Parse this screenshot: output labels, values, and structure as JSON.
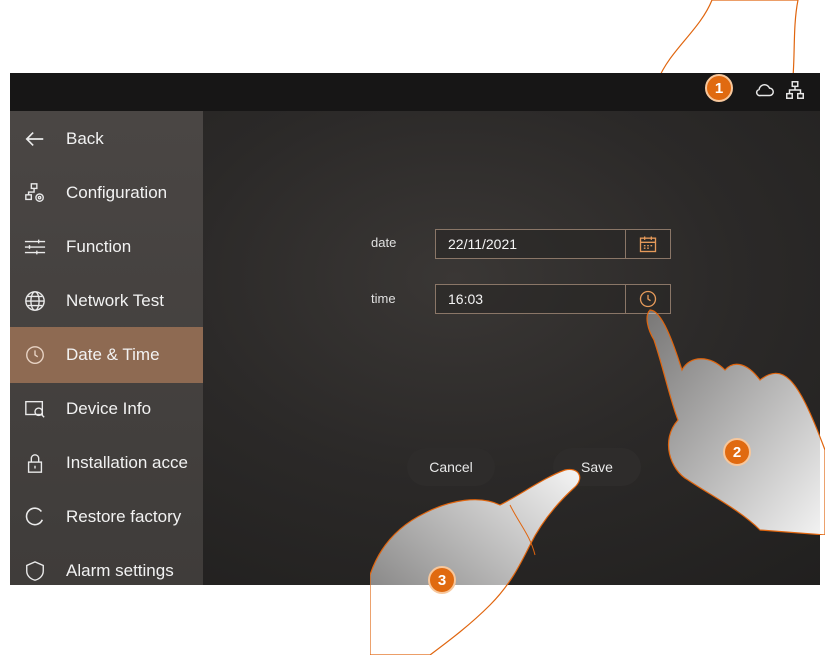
{
  "sidebar": {
    "items": [
      {
        "label": "Back",
        "icon": "back-arrow-icon"
      },
      {
        "label": "Configuration",
        "icon": "configuration-icon"
      },
      {
        "label": "Function",
        "icon": "sliders-icon"
      },
      {
        "label": "Network Test",
        "icon": "globe-icon"
      },
      {
        "label": "Date & Time",
        "icon": "clock-icon"
      },
      {
        "label": "Device Info",
        "icon": "device-info-icon"
      },
      {
        "label": "Installation acce",
        "icon": "lock-icon"
      },
      {
        "label": "Restore factory",
        "icon": "restore-icon"
      },
      {
        "label": "Alarm settings",
        "icon": "shield-icon"
      }
    ]
  },
  "form": {
    "date_label": "date",
    "date_value": "22/11/2021",
    "time_label": "time",
    "time_value": "16:03"
  },
  "buttons": {
    "cancel": "Cancel",
    "save": "Save"
  },
  "callouts": [
    "1",
    "2",
    "3"
  ],
  "colors": {
    "accent": "#e59a5a",
    "active_item": "#8e6a52",
    "badge": "#e06a10"
  }
}
